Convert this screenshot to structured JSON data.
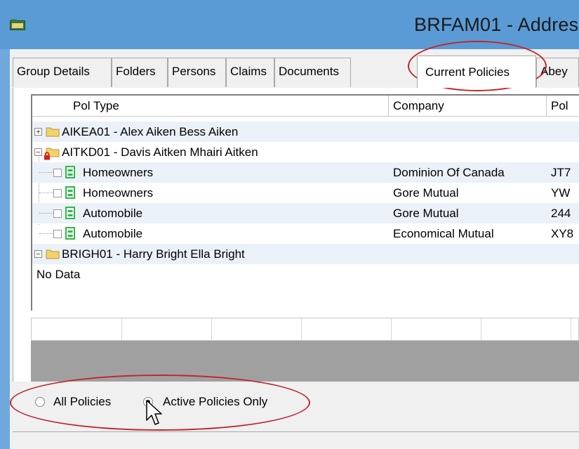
{
  "window": {
    "title": "BRFAM01 - Addres"
  },
  "tabs": [
    {
      "label": "Group Details",
      "active": false
    },
    {
      "label": "Folders",
      "active": false
    },
    {
      "label": "Persons",
      "active": false
    },
    {
      "label": "Claims",
      "active": false
    },
    {
      "label": "Documents",
      "active": false
    },
    {
      "label": "Current Policies",
      "active": true
    },
    {
      "label": "Abey",
      "active": false
    }
  ],
  "grid": {
    "columns": [
      "Pol Type",
      "Company",
      "Pol"
    ],
    "rows": [
      {
        "kind": "group",
        "label": "AIKEA01 - Alex Aiken Bess Aiken",
        "expanded": false,
        "locked": false
      },
      {
        "kind": "group",
        "label": "AITKD01 - Davis Aitken Mhairi Aitken",
        "expanded": true,
        "locked": true
      },
      {
        "kind": "policy",
        "pol_type": "Homeowners",
        "company": "Dominion Of Canada",
        "pol": "JT7"
      },
      {
        "kind": "policy",
        "pol_type": "Homeowners",
        "company": "Gore Mutual",
        "pol": "YW"
      },
      {
        "kind": "policy",
        "pol_type": "Automobile",
        "company": "Gore Mutual",
        "pol": "244"
      },
      {
        "kind": "policy",
        "pol_type": "Automobile",
        "company": "Economical Mutual",
        "pol": "XY8"
      },
      {
        "kind": "group",
        "label": "BRIGH01 - Harry Bright Ella Bright",
        "expanded": true,
        "locked": false
      },
      {
        "kind": "nodata",
        "label": "No Data"
      }
    ]
  },
  "filter": {
    "options": [
      {
        "label": "All Policies",
        "selected": false
      },
      {
        "label": "Active Policies Only",
        "selected": true
      }
    ]
  },
  "colors": {
    "titlebar": "#5b9bd5",
    "highlight": "#c0272d",
    "row_band": "#ebf1f8",
    "doc_icon": "#2db84a",
    "folder_icon": "#f2d36b"
  },
  "icons": [
    "app-icon",
    "folder-icon",
    "lock-icon",
    "document-icon",
    "expand-icon",
    "collapse-icon",
    "mouse-cursor-icon"
  ]
}
